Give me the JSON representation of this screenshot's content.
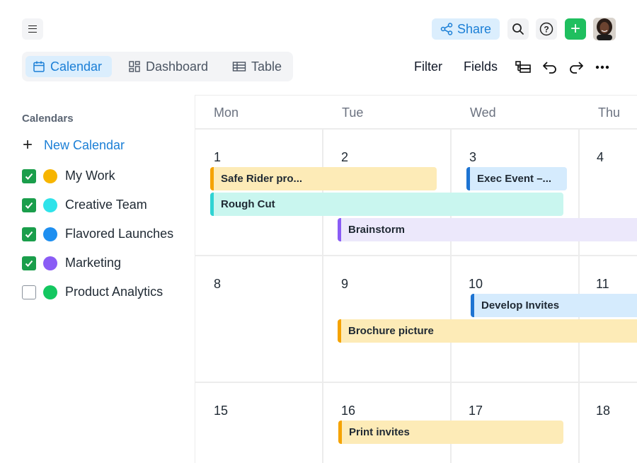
{
  "header": {
    "share_label": "Share",
    "add_label": "+"
  },
  "views": {
    "calendar": "Calendar",
    "dashboard": "Dashboard",
    "table": "Table"
  },
  "toolbar": {
    "filter": "Filter",
    "fields": "Fields"
  },
  "sidebar": {
    "title": "Calendars",
    "new_calendar": "New Calendar",
    "items": [
      {
        "label": "My Work",
        "checked": true,
        "color": "#f7b500"
      },
      {
        "label": "Creative Team",
        "checked": true,
        "color": "#2fe3ea"
      },
      {
        "label": "Flavored Launches",
        "checked": true,
        "color": "#1e8ff0"
      },
      {
        "label": "Marketing",
        "checked": true,
        "color": "#8a5cf5"
      },
      {
        "label": "Product Analytics",
        "checked": false,
        "color": "#14c760"
      }
    ]
  },
  "calendar": {
    "days": [
      "Mon",
      "Tue",
      "Wed",
      "Thu"
    ],
    "weeks": [
      [
        "1",
        "2",
        "3",
        "4"
      ],
      [
        "8",
        "9",
        "10",
        "11"
      ],
      [
        "15",
        "16",
        "17",
        "18"
      ]
    ],
    "events": [
      {
        "title": "Safe Rider pro...",
        "color": "yellow"
      },
      {
        "title": "Exec Event –...",
        "color": "blue"
      },
      {
        "title": "Rough Cut",
        "color": "cyan"
      },
      {
        "title": "Brainstorm",
        "color": "purple"
      },
      {
        "title": "Develop Invites",
        "color": "blue"
      },
      {
        "title": "Brochure picture",
        "color": "yellow"
      },
      {
        "title": "Print invites",
        "color": "yellow"
      }
    ]
  }
}
